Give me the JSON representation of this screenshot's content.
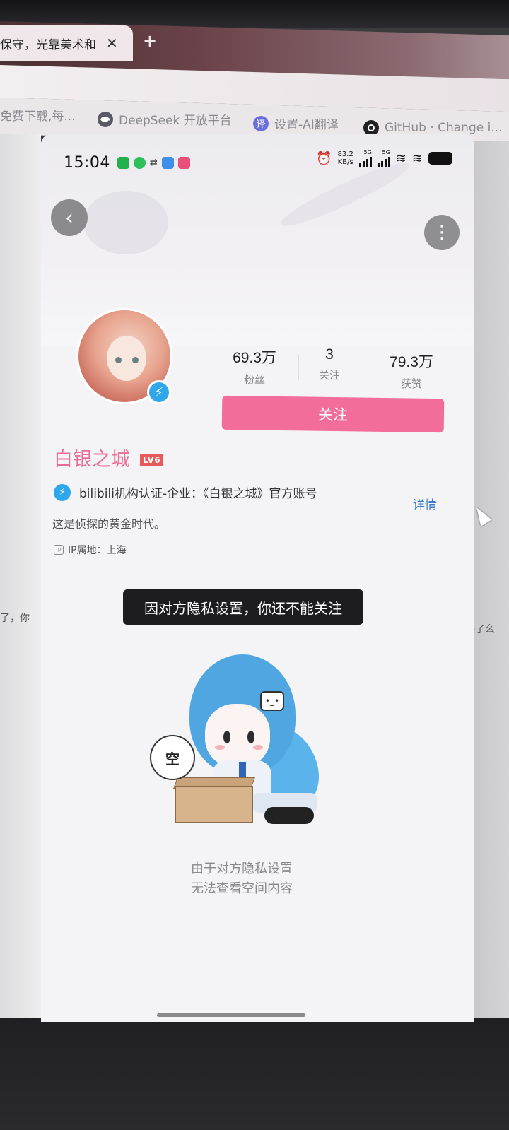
{
  "browser": {
    "active_tab_title": "保守，光靠美术和",
    "tab_close": "✕",
    "new_tab": "+",
    "bookmarks": [
      {
        "label": "免费下载,每...",
        "icon": "download-icon"
      },
      {
        "label": "DeepSeek 开放平台",
        "icon": "deepseek-whale-icon"
      },
      {
        "label": "设置-AI翻译",
        "icon": "translate-icon",
        "icon_glyph": "译"
      },
      {
        "label": "GitHub · Change i...",
        "icon": "github-icon"
      }
    ]
  },
  "desktop": {
    "left_text": "了，你",
    "right_text": "感若揭了么"
  },
  "status_bar": {
    "time": "15:04",
    "net_speed_value": "83.2",
    "net_speed_unit": "KB/s",
    "signal1_label": "5G",
    "signal2_label": "5G"
  },
  "profile": {
    "stats": [
      {
        "value": "69.3万",
        "label": "粉丝"
      },
      {
        "value": "3",
        "label": "关注"
      },
      {
        "value": "79.3万",
        "label": "获赞"
      }
    ],
    "follow_button": "关注",
    "username": "白银之城",
    "level_badge": "LV6",
    "certification": "bilibili机构认证-企业：《白银之城》官方账号",
    "detail_link": "详情",
    "bio": "这是侦探的黄金时代。",
    "ip_icon_glyph": "IP",
    "ip_location": "IP属地：上海"
  },
  "toast": {
    "message": "因对方隐私设置，你还不能关注"
  },
  "empty_state": {
    "bubble_text": "空",
    "line1": "由于对方隐私设置",
    "line2": "无法查看空间内容"
  },
  "colors": {
    "accent_pink": "#f26d9a",
    "username_pink": "#ec6d96",
    "link_blue": "#3c79c6",
    "verify_blue": "#2fa7ea",
    "level_red": "#e85a5a"
  }
}
